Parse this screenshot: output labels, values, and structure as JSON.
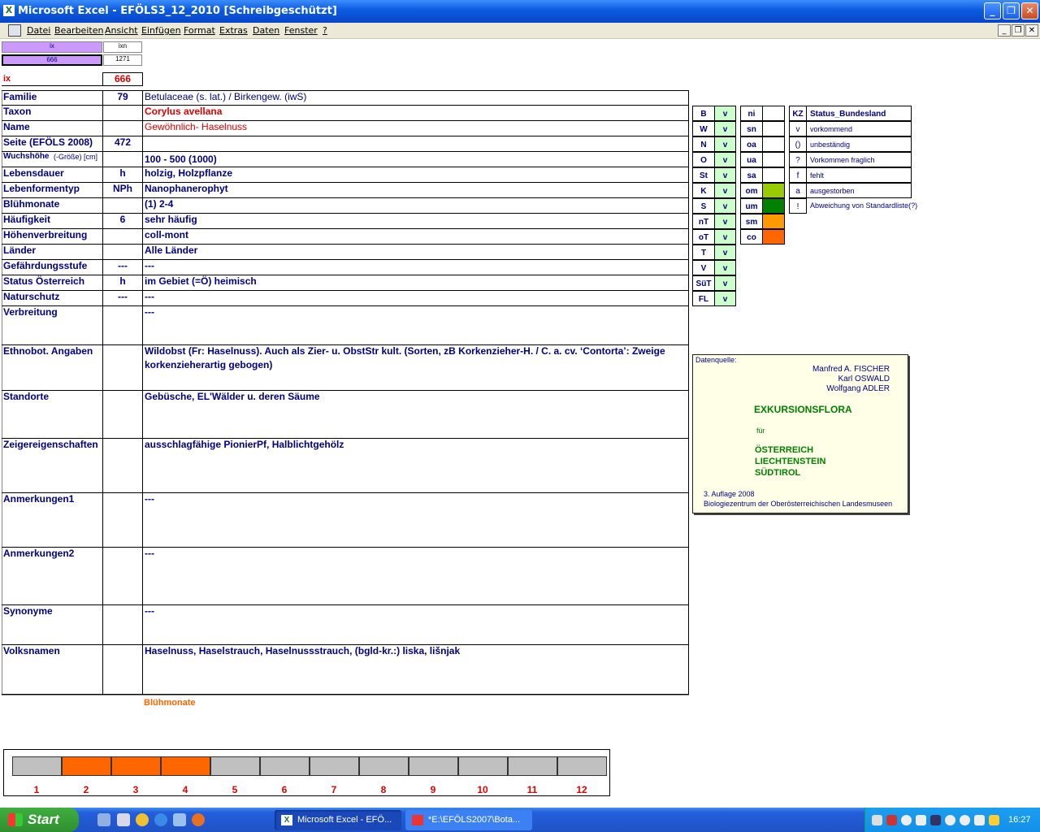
{
  "window": {
    "title": "Microsoft Excel - EFÖLS3_12_2010  [Schreibgeschützt]",
    "icon": "excel-icon",
    "controls": [
      "minimize",
      "restore",
      "close"
    ]
  },
  "menu": [
    "Datei",
    "Bearbeiten",
    "Ansicht",
    "Einfügen",
    "Format",
    "Extras",
    "Daten",
    "Fenster",
    "?"
  ],
  "top_cells": {
    "ix_header": "ix",
    "ixn_header": "ixn",
    "ix_value": "666",
    "ixn_value": "1271",
    "ix_label": "ix",
    "ix_big": "666"
  },
  "rows": [
    {
      "label": "Familie",
      "code": "79",
      "value": "Betulaceae (s. lat.)  /  Birkengew. (iwS)"
    },
    {
      "label": "Taxon",
      "code": "",
      "value": "Corylus avellana"
    },
    {
      "label": "Name",
      "code": "",
      "value": "Gewöhnlich- Haselnuss"
    },
    {
      "label": "Seite (EFÖLS 2008)",
      "code": "472",
      "value": ""
    },
    {
      "label": "Wuchshöhe",
      "label_suffix": "(-Größe) [cm]",
      "code": "",
      "value": "100 - 500 (1000)"
    },
    {
      "label": "Lebensdauer",
      "code": "h",
      "value": "holzig, Holzpflanze"
    },
    {
      "label": "Lebenformentyp",
      "code": "NPh",
      "value": "Nanophanerophyt"
    },
    {
      "label": "Blühmonate",
      "code": "",
      "value": "(1) 2-4"
    },
    {
      "label": "Häufigkeit",
      "code": "6",
      "value": "sehr häufig"
    },
    {
      "label": "Höhenverbreitung",
      "code": "",
      "value": "coll-mont"
    },
    {
      "label": "Länder",
      "code": "",
      "value": "Alle Länder"
    },
    {
      "label": "Gefährdungsstufe",
      "code": "---",
      "value": "---"
    },
    {
      "label": "Status Österreich",
      "code": "h",
      "value": "im Gebiet (=Ö) heimisch"
    },
    {
      "label": "Naturschutz",
      "code": "---",
      "value": "---"
    },
    {
      "label": "Verbreitung",
      "code": "",
      "value": "---"
    },
    {
      "label": "Ethnobot. Angaben",
      "code": "",
      "value": "Wildobst (Fr: Haselnuss). Auch als Zier- u. ObstStr kult. (Sorten, zB Korkenzieher-H. / C. a. cv. ‘Contorta’: Zweige",
      "value2": "korkenzieherartig gebogen)"
    },
    {
      "label": "Standorte",
      "code": "",
      "value": "Gebüsche, EL'Wälder u. deren Säume"
    },
    {
      "label": "Zeigereigenschaften",
      "code": "",
      "value": "ausschlagfähige PionierPf, Halblichtgehölz"
    },
    {
      "label": "Anmerkungen1",
      "code": "",
      "value": "---"
    },
    {
      "label": "Anmerkungen2",
      "code": "",
      "value": "---"
    },
    {
      "label": "Synonyme",
      "code": "",
      "value": "---"
    },
    {
      "label": "Volksnamen",
      "code": "",
      "value": "Haselnuss, Haselstrauch, Haselnussstrauch, (bgld-kr.:) liska, lišnjak"
    }
  ],
  "bundeslaender": [
    {
      "code": "B",
      "status": "v"
    },
    {
      "code": "W",
      "status": "v"
    },
    {
      "code": "N",
      "status": "v"
    },
    {
      "code": "O",
      "status": "v"
    },
    {
      "code": "St",
      "status": "v"
    },
    {
      "code": "K",
      "status": "v"
    },
    {
      "code": "S",
      "status": "v"
    },
    {
      "code": "nT",
      "status": "v"
    },
    {
      "code": "oT",
      "status": "v"
    },
    {
      "code": "T",
      "status": "v"
    },
    {
      "code": "V",
      "status": "v"
    },
    {
      "code": "SüT",
      "status": "v"
    },
    {
      "code": "FL",
      "status": "v"
    }
  ],
  "altitude": [
    {
      "code": "ni",
      "color": ""
    },
    {
      "code": "sn",
      "color": ""
    },
    {
      "code": "oa",
      "color": ""
    },
    {
      "code": "ua",
      "color": ""
    },
    {
      "code": "sa",
      "color": ""
    },
    {
      "code": "om",
      "color": "#99cc00"
    },
    {
      "code": "um",
      "color": "#008000"
    },
    {
      "code": "sm",
      "color": "#ff9900"
    },
    {
      "code": "co",
      "color": "#ff6600"
    }
  ],
  "status_legend": {
    "kz_header": "KZ",
    "title": "Status_Bundesland",
    "items": [
      {
        "kz": "v",
        "text": "vorkommend"
      },
      {
        "kz": "()",
        "text": "unbeständig"
      },
      {
        "kz": "?",
        "text": "Vorkommen fraglich"
      },
      {
        "kz": "f",
        "text": "fehlt"
      },
      {
        "kz": "a",
        "text": "ausgestorben"
      },
      {
        "kz": "!",
        "text": "Abweichung von Standardliste(?)"
      }
    ]
  },
  "source": {
    "label": "Datenquelle:",
    "authors": [
      "Manfred A. FISCHER",
      "Karl OSWALD",
      "Wolfgang ADLER"
    ],
    "book": "EXKURSIONSFLORA",
    "fuer": "für",
    "regions": [
      "ÖSTERREICH",
      "LIECHTENSTEIN",
      "SÜDTIROL"
    ],
    "edition": "3. Auflage 2008",
    "publisher": "Biologiezentrum der Oberösterreichischen Landesmuseen"
  },
  "chart_data": {
    "type": "bar",
    "title": "Blühmonate",
    "categories": [
      "1",
      "2",
      "3",
      "4",
      "5",
      "6",
      "7",
      "8",
      "9",
      "10",
      "11",
      "12"
    ],
    "values": [
      0,
      1,
      1,
      1,
      0,
      0,
      0,
      0,
      0,
      0,
      0,
      0
    ],
    "colors": {
      "active": "#ff6600",
      "inactive": "#c0c0c0"
    }
  },
  "taskbar": {
    "start": "Start",
    "tasks": [
      "Microsoft Excel - EFÖ...",
      "*E:\\EFÖLS2007\\Bota..."
    ],
    "clock": "16:27"
  }
}
